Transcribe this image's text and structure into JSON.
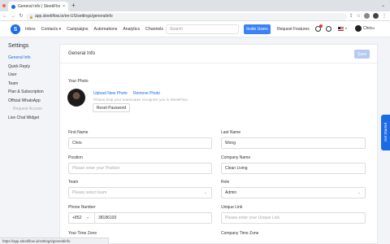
{
  "browser": {
    "tab_title": "General Info | SleekFlow",
    "tab_close": "×",
    "new_tab": "+",
    "url": "app.sleekflow.io/en-US/settings/generalinfo",
    "colors": {
      "close": "#ff5f57",
      "minimize": "#febc2e",
      "maximize": "#28c840"
    }
  },
  "header": {
    "nav": [
      "Inbox",
      "Contacts ▾",
      "Campaigns",
      "Automations",
      "Analytics",
      "Channels"
    ],
    "search_placeholder": "Search",
    "invite_label": "Invite Users",
    "request_label": "Request Features",
    "user_name": "Chris",
    "logo_letter": "S"
  },
  "sidebar": {
    "title": "Settings",
    "items": [
      {
        "label": "General Info",
        "active": true
      },
      {
        "label": "Quick Reply"
      },
      {
        "label": "User"
      },
      {
        "label": "Team"
      },
      {
        "label": "Plan & Subscription"
      },
      {
        "label": "Official WhatsApp"
      },
      {
        "label": "Request Access",
        "sub": true
      },
      {
        "label": "Live Chat Widget"
      }
    ]
  },
  "main": {
    "title": "General Info",
    "save_label": "Save",
    "photo": {
      "label": "Your Photo",
      "upload": "Upload New Photo",
      "remove": "Remove Photo",
      "help": "Photos help your teammates recognize you in SleekFlow.",
      "reset": "Reset Password"
    },
    "fields": {
      "first_name": {
        "label": "First Name",
        "value": "Chris"
      },
      "last_name": {
        "label": "Last Name",
        "value": "Wong"
      },
      "position": {
        "label": "Position",
        "placeholder": "Please enter your Position"
      },
      "company_name": {
        "label": "Company Name",
        "value": "Clean Living"
      },
      "team": {
        "label": "Team",
        "placeholder": "Please select team"
      },
      "role": {
        "label": "Role",
        "value": "Admin"
      },
      "phone": {
        "label": "Phone Number",
        "country_code": "+852",
        "value": "38186100"
      },
      "unique_link": {
        "label": "Unique Link",
        "placeholder": "Please enter your Unique Link"
      },
      "time_zone": {
        "label": "Your Time Zone"
      },
      "company_time_zone": {
        "label": "Company Time Zone"
      }
    }
  },
  "status_url": "https://app.sleekflow.io/settings/generalinfo",
  "get_started": "Get Started"
}
